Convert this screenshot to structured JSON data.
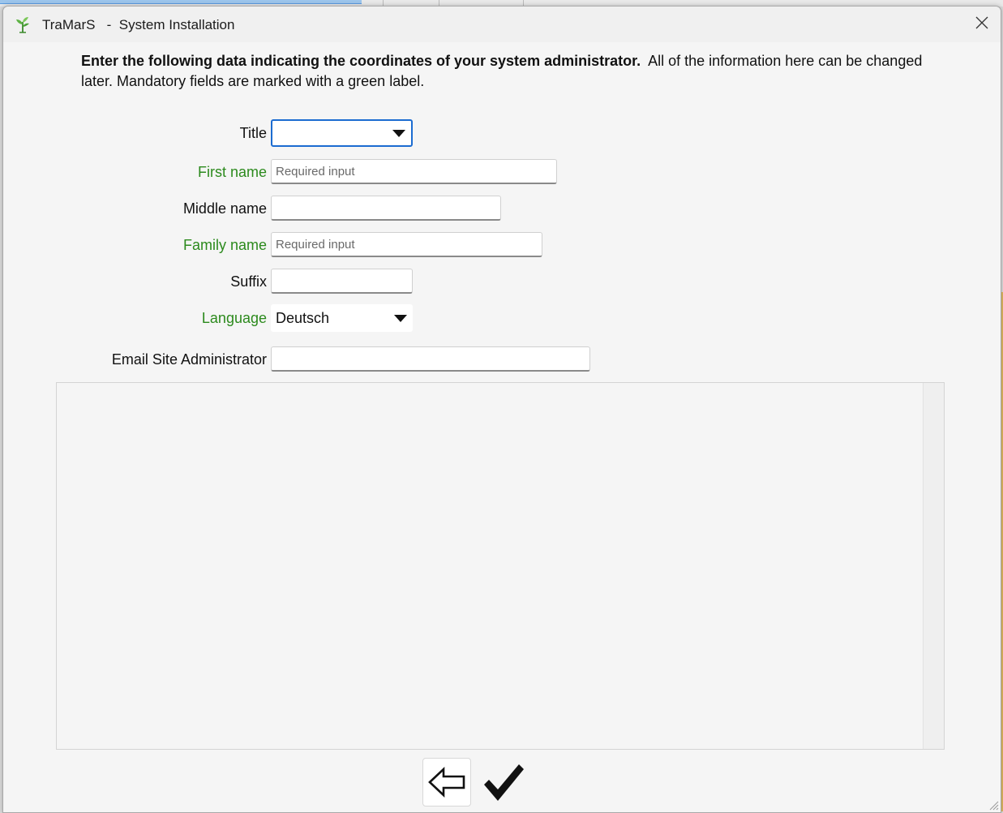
{
  "window": {
    "app_name": "TraMarS",
    "title": "System Installation",
    "title_separator": "-"
  },
  "intro": {
    "bold_text": "Enter the following data indicating the coordinates of your system administrator.",
    "normal_text": "All of the information here can be changed later.  Mandatory fields are marked with a green  label."
  },
  "form": {
    "title": {
      "label": "Title",
      "value": ""
    },
    "first_name": {
      "label": "First name",
      "placeholder": "Required input",
      "value": ""
    },
    "middle_name": {
      "label": "Middle name",
      "value": ""
    },
    "family_name": {
      "label": "Family name",
      "placeholder": "Required input",
      "value": ""
    },
    "suffix": {
      "label": "Suffix",
      "value": ""
    },
    "language": {
      "label": "Language",
      "value": "Deutsch"
    },
    "email": {
      "label": "Email Site Administrator",
      "value": ""
    }
  },
  "colors": {
    "mandatory_label": "#2c8a1d",
    "focus_border": "#1c6cd1",
    "window_bg": "#f5f5f5"
  },
  "icons": {
    "app": "plant-icon",
    "close": "close-icon",
    "back": "back-arrow-icon",
    "confirm": "checkmark-icon",
    "dropdown": "dropdown-arrow-icon"
  }
}
